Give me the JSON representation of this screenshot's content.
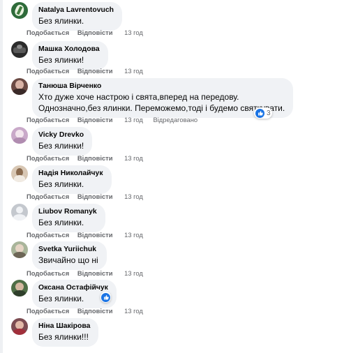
{
  "labels": {
    "like": "Подобається",
    "reply": "Відповісти",
    "edited": "Відредаговано"
  },
  "icons": {
    "reaction": "like-icon"
  },
  "colors": {
    "bubble": "#f0f2f5",
    "meta": "#65676b",
    "like": "#1b74e4"
  },
  "comments": [
    {
      "author": "Natalya Lavrentovuch",
      "lines": [
        "Без ялинки."
      ],
      "time": "13 год"
    },
    {
      "author": "Машка Холодова",
      "lines": [
        "Без ялинки!"
      ],
      "time": "13 год"
    },
    {
      "author": "Танюша Вірченко",
      "lines": [
        "Хто дуже хоче настрою і свята,вперед на передову.",
        "Однозначно,без ялинки. Переможемо,тоді і будемо святкувати."
      ],
      "time": "13 год",
      "edited": true,
      "reaction_count": "3"
    },
    {
      "author": "Vicky Drevko",
      "lines": [
        "Без ялинки!"
      ],
      "time": "13 год"
    },
    {
      "author": "Надія Николайчук",
      "lines": [
        "Без ялинки."
      ],
      "time": "13 год"
    },
    {
      "author": "Liubov Romanyk",
      "lines": [
        "Без ялинки."
      ],
      "time": "13 год"
    },
    {
      "author": "Svetka Yuriichuk",
      "lines": [
        "Звичайно що ні"
      ],
      "time": "13 год"
    },
    {
      "author": "Оксана Остафійчук",
      "lines": [
        "Без ялинки."
      ],
      "time": "13 год",
      "reaction_count": ""
    },
    {
      "author": "Ніна Шакірова",
      "lines": [
        "Без ялинки!!!"
      ],
      "time": "13 год"
    }
  ]
}
